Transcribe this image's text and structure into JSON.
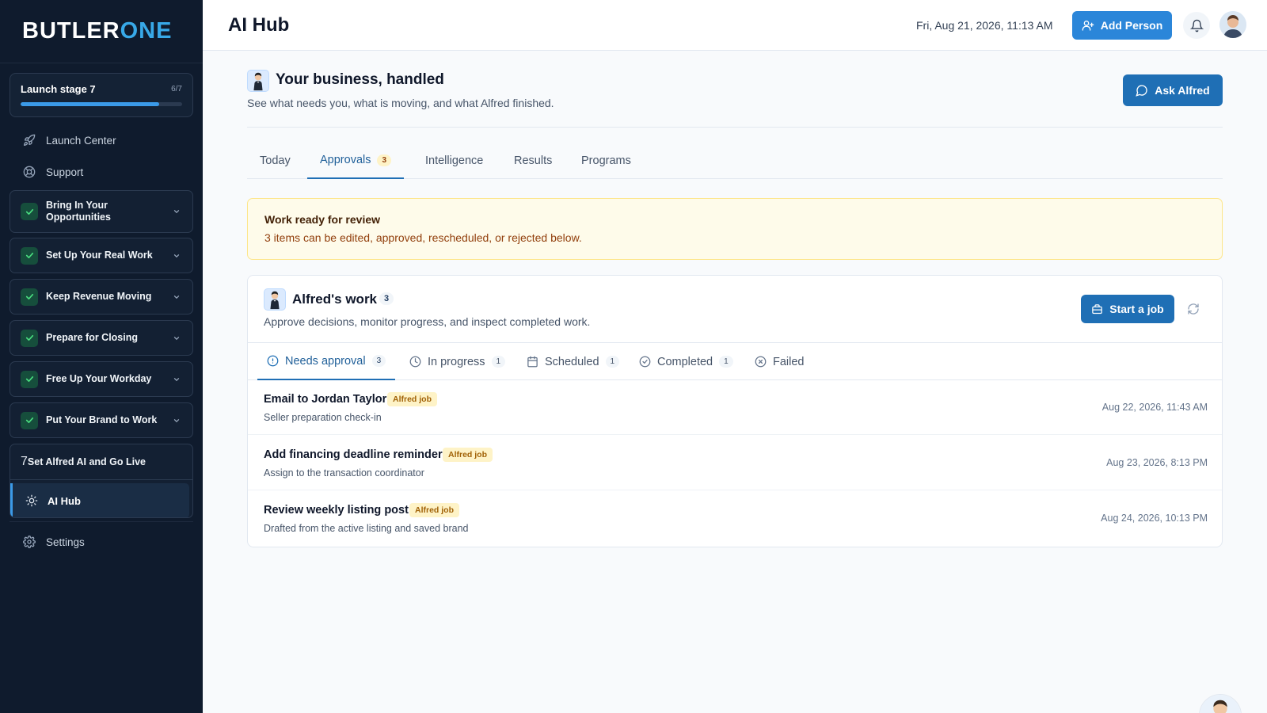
{
  "brand": {
    "logo_a": "BUTLER",
    "logo_b": "ONE",
    "accent": "#38a9e8"
  },
  "launch": {
    "title": "Launch stage 7",
    "count": "6/7",
    "progress_fraction": 0.857
  },
  "nav": {
    "launch_center": "Launch Center",
    "support": "Support",
    "settings": "Settings"
  },
  "steps": [
    {
      "label": "Bring In Your Opportunities",
      "status": "complete"
    },
    {
      "label": "Set Up Your Real Work",
      "status": "complete"
    },
    {
      "label": "Keep Revenue Moving",
      "status": "complete"
    },
    {
      "label": "Prepare for Closing",
      "status": "complete"
    },
    {
      "label": "Free Up Your Workday",
      "status": "complete"
    },
    {
      "label": "Put Your Brand to Work",
      "status": "complete"
    }
  ],
  "current_step": {
    "number": "7",
    "label": "Set Alfred AI and Go Live",
    "sub_item": "AI Hub"
  },
  "header": {
    "title": "AI Hub",
    "datetime": "Fri, Aug 21, 2026, 11:13 AM",
    "add_person": "Add Person"
  },
  "hero": {
    "title": "Your business, handled",
    "subtitle": "See what needs you, what is moving, and what Alfred finished.",
    "ask_button": "Ask Alfred"
  },
  "tabs": [
    {
      "label": "Today"
    },
    {
      "label": "Approvals",
      "badge": "3",
      "active": true
    },
    {
      "label": "Intelligence"
    },
    {
      "label": "Results"
    },
    {
      "label": "Programs"
    }
  ],
  "alert": {
    "title": "Work ready for review",
    "text": "3 items can be edited, approved, rescheduled, or rejected below."
  },
  "work": {
    "title": "Alfred's work",
    "count": "3",
    "subtitle": "Approve decisions, monitor progress, and inspect completed work.",
    "start_job": "Start a job",
    "subtabs": [
      {
        "label": "Needs approval",
        "count": "3",
        "icon": "alert-circle-icon",
        "active": true
      },
      {
        "label": "In progress",
        "count": "1",
        "icon": "clock-icon"
      },
      {
        "label": "Scheduled",
        "count": "1",
        "icon": "calendar-icon"
      },
      {
        "label": "Completed",
        "count": "1",
        "icon": "check-circle-icon"
      },
      {
        "label": "Failed",
        "count": "",
        "icon": "x-circle-icon"
      }
    ],
    "jobs": [
      {
        "title": "Email to Jordan Taylor",
        "tag": "Alfred job",
        "desc": "Seller preparation check-in",
        "time": "Aug 22, 2026, 11:43 AM"
      },
      {
        "title": "Add financing deadline reminder",
        "tag": "Alfred job",
        "desc": "Assign to the transaction coordinator",
        "time": "Aug 23, 2026, 8:13 PM"
      },
      {
        "title": "Review weekly listing post",
        "tag": "Alfred job",
        "desc": "Drafted from the active listing and saved brand",
        "time": "Aug 24, 2026, 10:13 PM"
      }
    ]
  }
}
